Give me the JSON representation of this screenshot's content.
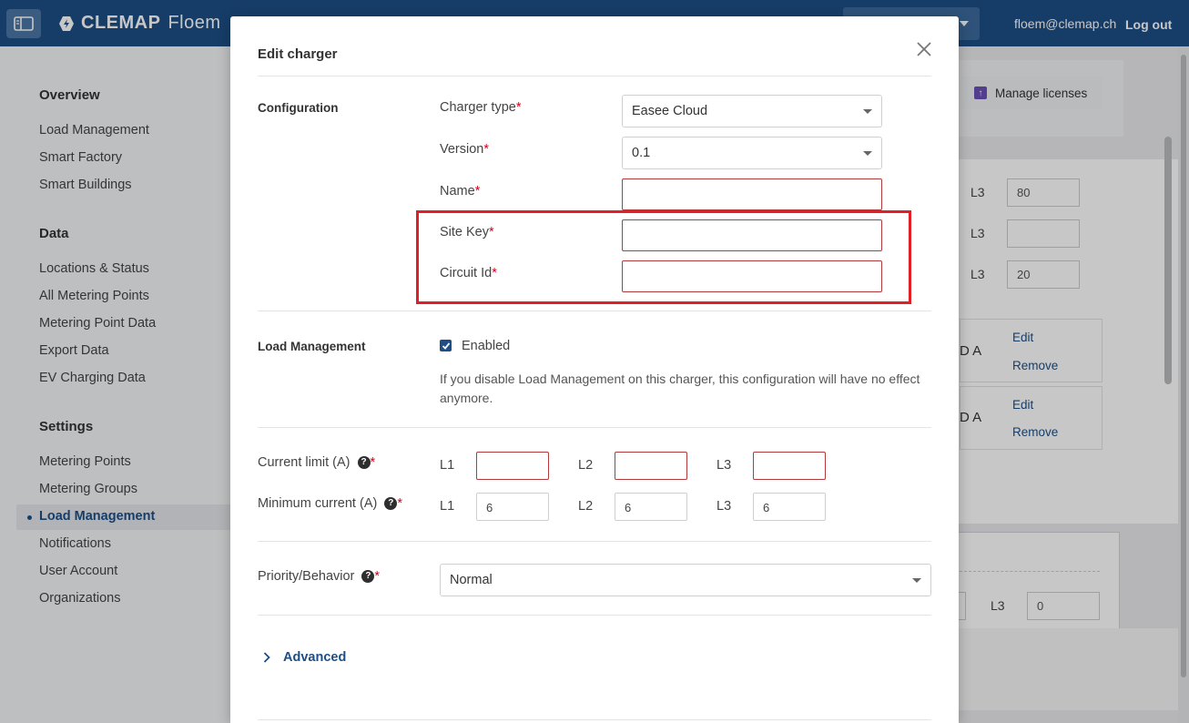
{
  "header": {
    "brand_name": "CLEMAP",
    "brand_sub": "Floem",
    "user_email": "floem@clemap.ch",
    "logout_label": "Log out"
  },
  "nav": {
    "sections": [
      {
        "title": "Overview",
        "items": [
          "Load Management",
          "Smart Factory",
          "Smart Buildings"
        ]
      },
      {
        "title": "Data",
        "items": [
          "Locations & Status",
          "All Metering Points",
          "Metering Point Data",
          "Export Data",
          "EV Charging Data"
        ]
      },
      {
        "title": "Settings",
        "items": [
          "Metering Points",
          "Metering Groups",
          "Load Management",
          "Notifications",
          "User Account",
          "Organizations"
        ]
      }
    ],
    "active_item": "Load Management"
  },
  "background": {
    "manage_licenses_label": "Manage licenses",
    "phase_label": "L3",
    "inputs": [
      "80",
      "",
      "20"
    ],
    "amp_suffix": "D A",
    "edit_label": "Edit",
    "remove_label": "Remove",
    "bottom_input_value": "0"
  },
  "modal": {
    "title": "Edit charger",
    "configuration": {
      "group_label": "Configuration",
      "charger_type_label": "Charger type",
      "charger_type_value": "Easee Cloud",
      "version_label": "Version",
      "version_value": "0.1",
      "name_label": "Name",
      "name_value": "",
      "site_key_label": "Site Key",
      "site_key_value": "",
      "circuit_id_label": "Circuit Id",
      "circuit_id_value": "",
      "required_marker": "*"
    },
    "load_management": {
      "group_label": "Load Management",
      "enabled_label": "Enabled",
      "enabled": true,
      "help_text": "If you disable Load Management on this charger, this configuration will have no effect anymore."
    },
    "current_limit": {
      "label": "Current limit (A)",
      "phases": [
        "L1",
        "L2",
        "L3"
      ],
      "values": [
        "",
        "",
        ""
      ]
    },
    "minimum_current": {
      "label": "Minimum current (A)",
      "phases": [
        "L1",
        "L2",
        "L3"
      ],
      "values": [
        "6",
        "6",
        "6"
      ]
    },
    "priority": {
      "label": "Priority/Behavior",
      "value": "Normal"
    },
    "advanced_label": "Advanced",
    "help_glyph": "?"
  },
  "colors": {
    "header_bg": "#1d4f86",
    "accent": "#1d4f86",
    "required": "#d0021b",
    "highlight": "#e01f26"
  }
}
